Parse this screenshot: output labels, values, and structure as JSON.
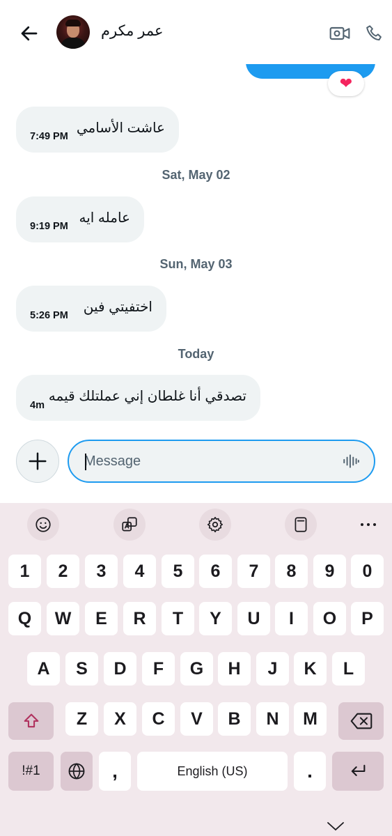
{
  "header": {
    "contact_name": "عمر مكرم"
  },
  "messages": [
    {
      "text": "عاشت الأسامي",
      "time": "7:49 PM"
    },
    {
      "text": "عامله ايه",
      "time": "9:19 PM"
    },
    {
      "text": "اختفيتي فين",
      "time": "5:26 PM"
    },
    {
      "text": "تصدقي أنا غلطان إني عملتلك قيمه",
      "time": "4m"
    }
  ],
  "reaction": "❤",
  "date_separators": [
    "Sat, May 02",
    "Sun, May 03",
    "Today"
  ],
  "composer": {
    "placeholder": "Message"
  },
  "keyboard": {
    "row_numbers": [
      "1",
      "2",
      "3",
      "4",
      "5",
      "6",
      "7",
      "8",
      "9",
      "0"
    ],
    "row_q": [
      "Q",
      "W",
      "E",
      "R",
      "T",
      "Y",
      "U",
      "I",
      "O",
      "P"
    ],
    "row_a": [
      "A",
      "S",
      "D",
      "F",
      "G",
      "H",
      "J",
      "K",
      "L"
    ],
    "row_z": [
      "Z",
      "X",
      "C",
      "V",
      "B",
      "N",
      "M"
    ],
    "symbols_label": "!#1",
    "comma": ",",
    "space_label": "English (US)",
    "period": "."
  },
  "colors": {
    "accent": "#1d9bf0",
    "bubble": "#eff3f4",
    "muted_text": "#536471",
    "keyboard_bg": "#f2e8ec",
    "function_key": "#dcc8d1"
  }
}
